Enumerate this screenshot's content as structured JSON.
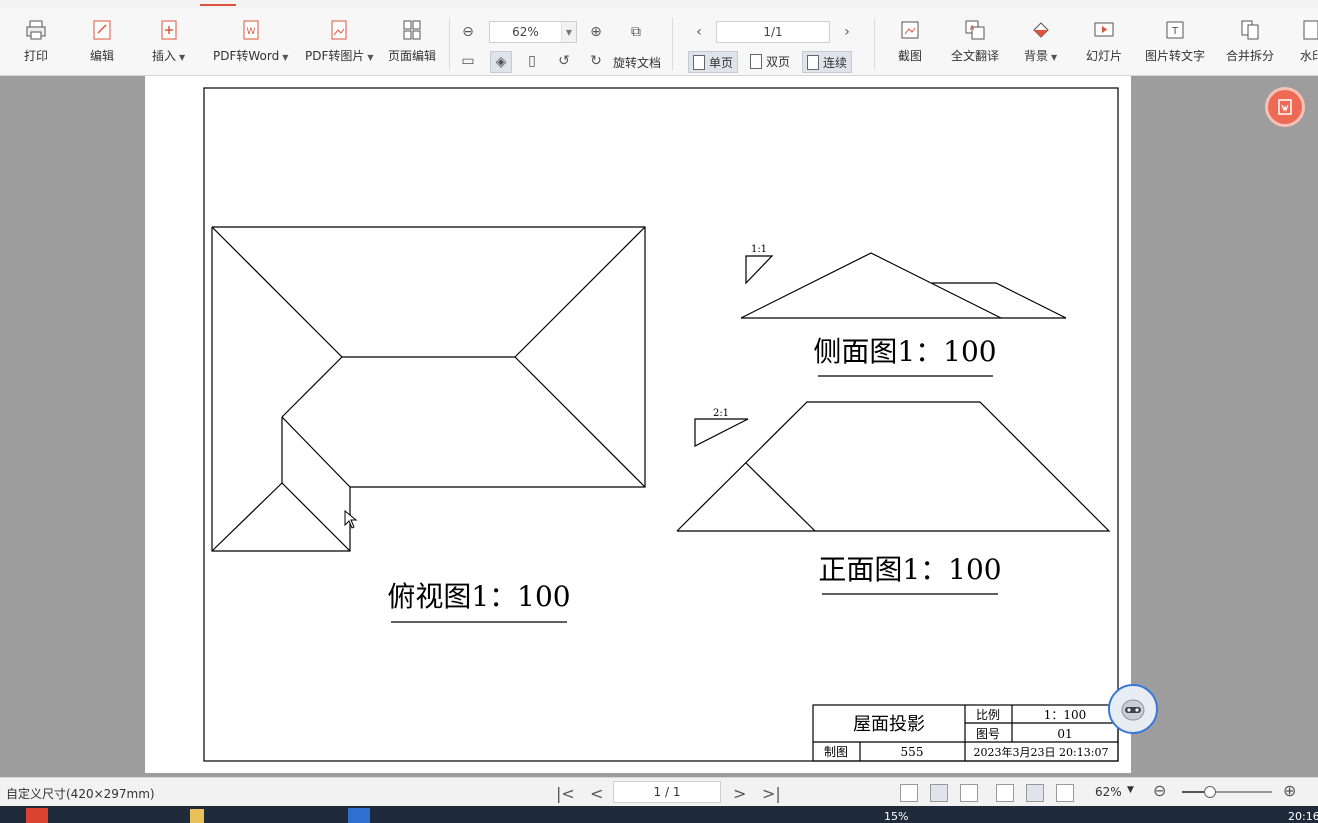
{
  "toolbar": {
    "print": "打印",
    "edit": "编辑",
    "insert": "插入",
    "pdf_to_word": "PDF转Word",
    "pdf_to_image": "PDF转图片",
    "page_edit": "页面编辑",
    "zoom_value": "62%",
    "rotate_doc": "旋转文档",
    "page_value": "1/1",
    "single_page": "单页",
    "double_page": "双页",
    "continuous": "连续",
    "screenshot": "截图",
    "full_translate": "全文翻译",
    "background": "背景",
    "slideshow": "幻灯片",
    "image_to_text": "图片转文字",
    "merge_split": "合并拆分",
    "watermark_partial": "水印"
  },
  "drawing": {
    "top_view_label": "俯视图1：100",
    "side_view_label": "侧面图1：100",
    "front_view_label": "正面图1：100",
    "side_slope": "1:1",
    "front_slope": "2:1",
    "title_block": {
      "title": "屋面投影",
      "scale_label": "比例",
      "scale_value": "1：100",
      "drawing_no_label": "图号",
      "drawing_no_value": "01",
      "drafter_label": "制图",
      "drafter_value": "555",
      "datetime": "2023年3月23日  20:13:07"
    }
  },
  "status": {
    "page_size": "自定义尺寸(420×297mm)",
    "page_indicator": "1 / 1",
    "zoom": "62%"
  },
  "taskbar": {
    "cpu": "15%",
    "time": "20:16"
  },
  "colors": {
    "accent": "#e0533b",
    "workspace": "#9d9d9d",
    "float_button": "#ee6a55"
  }
}
